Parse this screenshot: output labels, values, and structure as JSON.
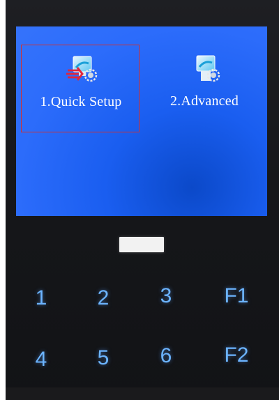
{
  "screen": {
    "menu": [
      {
        "label": "1.Quick Setup",
        "icon": "quick-setup-icon",
        "selected": true
      },
      {
        "label": "2.Advanced",
        "icon": "advanced-settings-icon",
        "selected": false
      }
    ],
    "selection_color": "#d23030",
    "background_color": "#2c6cfb"
  },
  "keypad": {
    "row1": [
      "1",
      "2",
      "3",
      "F1"
    ],
    "row2": [
      "4",
      "5",
      "6",
      "F2"
    ],
    "key_color": "#6cb4ff"
  }
}
